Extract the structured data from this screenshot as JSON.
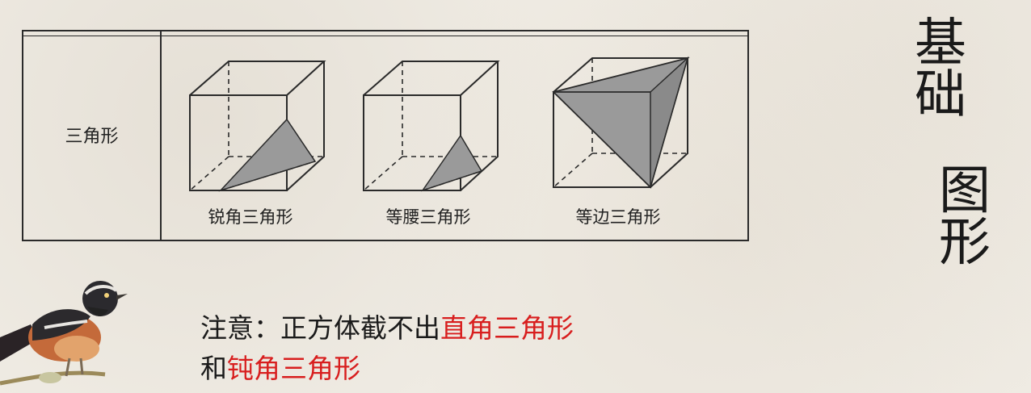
{
  "table": {
    "row_label": "三角形",
    "captions": [
      "锐角三角形",
      "等腰三角形",
      "等边三角形"
    ]
  },
  "side_title": {
    "line1": "基础",
    "line2": "图形"
  },
  "note": {
    "line1_plain": "注意：正方体截不出",
    "line1_red": "直角三角形",
    "line2_plain": "和",
    "line2_red": "钝角三角形"
  },
  "colors": {
    "accent_red": "#d81e1e",
    "section_fill": "#9a9a9a"
  },
  "icons": [
    "bird-illustration"
  ]
}
